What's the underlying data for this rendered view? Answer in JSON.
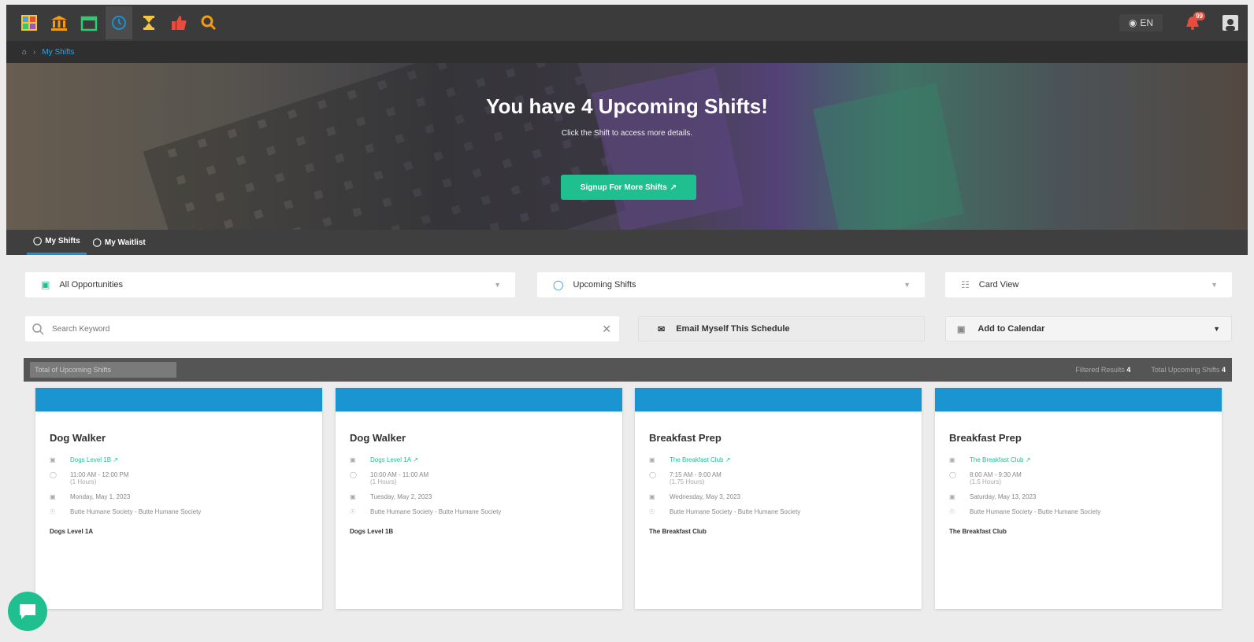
{
  "topnav": {
    "icons": [
      "dashboard-icon",
      "organization-icon",
      "calendar-icon",
      "clock-icon",
      "hourglass-icon",
      "thumbs-up-icon",
      "search-icon"
    ],
    "language": "EN",
    "notification_count": "99"
  },
  "breadcrumb": {
    "current": "My Shifts"
  },
  "hero": {
    "title": "You have 4 Upcoming Shifts!",
    "subtitle": "Click the Shift to access more details.",
    "signup_label": "Signup For More Shifts"
  },
  "tabs": [
    {
      "label": "My Shifts",
      "active": true
    },
    {
      "label": "My Waitlist",
      "active": false
    }
  ],
  "filters": {
    "opportunities": "All Opportunities",
    "shift_filter": "Upcoming Shifts",
    "view": "Card View",
    "search_placeholder": "Search Keyword",
    "email_label": "Email Myself This Schedule",
    "calendar_label": "Add to Calendar"
  },
  "results": {
    "label": "Total of Upcoming Shifts",
    "filtered_label": "Filtered Results",
    "filtered_count": "4",
    "total_label": "Total Upcoming Shifts",
    "total_count": "4"
  },
  "cards": [
    {
      "title": "Dog Walker",
      "location": "Dogs Level 1B",
      "time": "11:00 AM - 12:00 PM",
      "duration": "(1 Hours)",
      "date": "Monday, May 1, 2023",
      "org": "Butte Humane Society - Butte Humane Society",
      "footer": "Dogs Level 1A"
    },
    {
      "title": "Dog Walker",
      "location": "Dogs Level 1A",
      "time": "10:00 AM - 11:00 AM",
      "duration": "(1 Hours)",
      "date": "Tuesday, May 2, 2023",
      "org": "Butte Humane Society - Butte Humane Society",
      "footer": "Dogs Level 1B"
    },
    {
      "title": "Breakfast Prep",
      "location": "The Breakfast Club",
      "time": "7:15 AM - 9:00 AM",
      "duration": "(1.75 Hours)",
      "date": "Wednesday, May 3, 2023",
      "org": "Butte Humane Society - Butte Humane Society",
      "footer": "The Breakfast Club"
    },
    {
      "title": "Breakfast Prep",
      "location": "The Breakfast Club",
      "time": "8:00 AM - 9:30 AM",
      "duration": "(1.5 Hours)",
      "date": "Saturday, May 13, 2023",
      "org": "Butte Humane Society - Butte Humane Society",
      "footer": "The Breakfast Club"
    }
  ],
  "colors": {
    "accent": "#1fbf8f",
    "card_header": "#1a95d1",
    "nav": "#3b3b3b"
  }
}
